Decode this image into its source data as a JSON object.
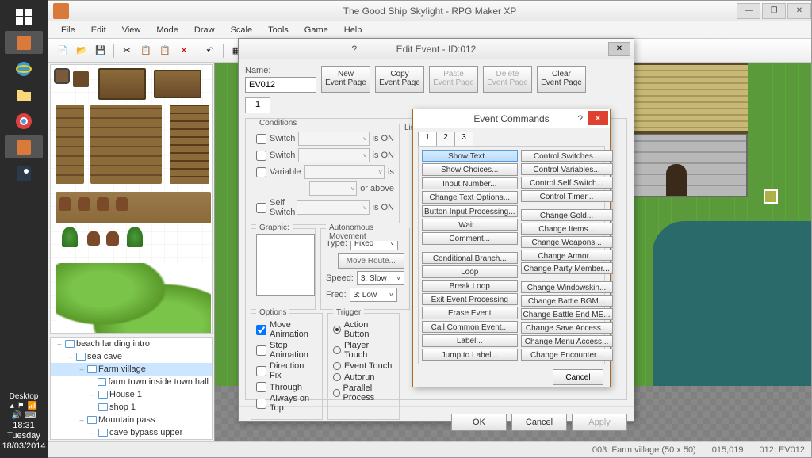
{
  "app": {
    "title": "The Good Ship Skylight - RPG Maker XP"
  },
  "menu": [
    "File",
    "Edit",
    "View",
    "Mode",
    "Draw",
    "Scale",
    "Tools",
    "Game",
    "Help"
  ],
  "taskbar": {
    "desktop_label": "Desktop",
    "time": "18:31",
    "day": "Tuesday",
    "date": "18/03/2014"
  },
  "tree": [
    {
      "indent": 0,
      "exp": "–",
      "label": "beach landing intro"
    },
    {
      "indent": 1,
      "exp": "–",
      "label": "sea cave"
    },
    {
      "indent": 2,
      "exp": "–",
      "label": "Farm village",
      "selected": true
    },
    {
      "indent": 3,
      "exp": "",
      "label": "farm town inside town hall"
    },
    {
      "indent": 3,
      "exp": "–",
      "label": "House 1"
    },
    {
      "indent": 3,
      "exp": "",
      "label": "shop 1"
    },
    {
      "indent": 2,
      "exp": "–",
      "label": "Mountain pass"
    },
    {
      "indent": 3,
      "exp": "–",
      "label": "cave bypass upper"
    }
  ],
  "status": {
    "map": "003: Farm village (50 x 50)",
    "coords": "015,019",
    "event": "012: EV012"
  },
  "edit_event": {
    "title": "Edit Event - ID:012",
    "name_label": "Name:",
    "name_value": "EV012",
    "btn_new": "New\nEvent Page",
    "btn_copy": "Copy\nEvent Page",
    "btn_paste": "Paste\nEvent Page",
    "btn_delete": "Delete\nEvent Page",
    "btn_clear": "Clear\nEvent Page",
    "tab": "1",
    "legend_conditions": "Conditions",
    "cond_switch": "Switch",
    "cond_variable": "Variable",
    "cond_self": "Self Switch",
    "is_on": "is ON",
    "is": "is",
    "or_above": "or above",
    "legend_graphic": "Graphic:",
    "legend_move": "Autonomous Movement",
    "move_type_label": "Type:",
    "move_type": "Fixed",
    "move_route": "Move Route...",
    "speed_label": "Speed:",
    "speed": "3: Slow",
    "freq_label": "Freq:",
    "freq": "3: Low",
    "legend_options": "Options",
    "opt_moveanim": "Move Animation",
    "opt_stopanim": "Stop Animation",
    "opt_dirfix": "Direction Fix",
    "opt_through": "Through",
    "opt_ontop": "Always on Top",
    "legend_trigger": "Trigger",
    "trg_action": "Action Button",
    "trg_player": "Player Touch",
    "trg_event": "Event Touch",
    "trg_auto": "Autorun",
    "trg_parallel": "Parallel Process",
    "cmd_list_label": "List of Event Commands:",
    "ok": "OK",
    "cancel": "Cancel",
    "apply": "Apply"
  },
  "event_cmds": {
    "title": "Event Commands",
    "tabs": [
      "1",
      "2",
      "3"
    ],
    "col1": [
      "Show Text...",
      "Show Choices...",
      "Input Number...",
      "Change Text Options...",
      "Button Input Processing...",
      "Wait...",
      "Comment...",
      "",
      "Conditional Branch...",
      "Loop",
      "Break Loop",
      "Exit Event Processing",
      "Erase Event",
      "Call Common Event...",
      "Label...",
      "Jump to Label..."
    ],
    "col2": [
      "Control Switches...",
      "Control Variables...",
      "Control Self Switch...",
      "Control Timer...",
      "",
      "Change Gold...",
      "Change Items...",
      "Change Weapons...",
      "Change Armor...",
      "Change Party Member...",
      "",
      "Change Windowskin...",
      "Change Battle BGM...",
      "Change Battle End ME...",
      "Change Save Access...",
      "Change Menu Access...",
      "Change Encounter..."
    ],
    "cancel": "Cancel"
  }
}
